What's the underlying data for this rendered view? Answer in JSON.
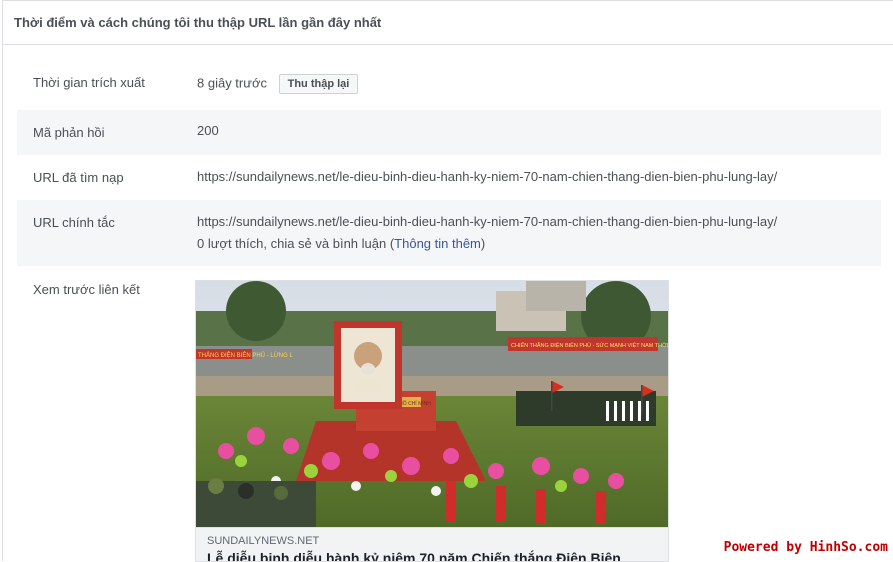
{
  "header": {
    "title": "Thời điểm và cách chúng tôi thu thập URL lần gần đây nhất"
  },
  "rows": {
    "scrape_time": {
      "label": "Thời gian trích xuất",
      "value": "8 giây trước",
      "button": "Thu thập lại"
    },
    "response_code": {
      "label": "Mã phản hồi",
      "value": "200"
    },
    "fetched_url": {
      "label": "URL đã tìm nạp",
      "value": "https://sundailynews.net/le-dieu-binh-dieu-hanh-ky-niem-70-nam-chien-thang-dien-bien-phu-lung-lay/"
    },
    "canonical_url": {
      "label": "URL chính tắc",
      "value": "https://sundailynews.net/le-dieu-binh-dieu-hanh-ky-niem-70-nam-chien-thang-dien-bien-phu-lung-lay/",
      "engagement_prefix": "0 lượt thích, chia sẻ và bình luận (",
      "engagement_link": "Thông tin thêm",
      "engagement_suffix": ")"
    },
    "link_preview": {
      "label": "Xem trước liên kết",
      "domain": "SUNDAILYNEWS.NET",
      "title": "Lễ diễu binh diễu hành kỷ niệm 70 năm Chiến thắng Điện Biên",
      "banner_left": "THẮNG ĐIỆN BIÊN PHỦ - LỪNG L",
      "banner_right": "CHIẾN THẮNG ĐIỆN BIÊN PHỦ - SỨC MẠNH VIỆT NAM THỜI ĐẠI HỒ CHÍ MINH!",
      "float_label": "CHỦ TỊCH HỒ CHÍ MINH"
    }
  },
  "watermark": "Powered by HinhSo.com"
}
